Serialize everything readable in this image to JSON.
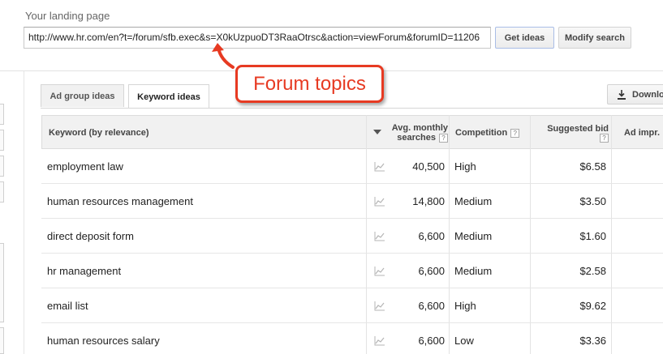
{
  "landing": {
    "label": "Your landing page",
    "url": "http://www.hr.com/en?t=/forum/sfb.exec&s=X0kUzpuoDT3RaaOtrsc&action=viewForum&forumID=11206",
    "get_ideas_label": "Get ideas",
    "modify_search_label": "Modify search"
  },
  "tabs": [
    {
      "label": "Ad group ideas",
      "active": false
    },
    {
      "label": "Keyword ideas",
      "active": true
    }
  ],
  "download_label": "Download",
  "table": {
    "headers": {
      "keyword": "Keyword (by relevance)",
      "avg_line1": "Avg. monthly",
      "avg_line2": "searches",
      "competition": "Competition",
      "bid": "Suggested bid",
      "ad_impr": "Ad impr."
    },
    "help_glyph": "?",
    "rows": [
      {
        "keyword": "employment law",
        "searches": "40,500",
        "competition": "High",
        "bid": "$6.58"
      },
      {
        "keyword": "human resources management",
        "searches": "14,800",
        "competition": "Medium",
        "bid": "$3.50"
      },
      {
        "keyword": "direct deposit form",
        "searches": "6,600",
        "competition": "Medium",
        "bid": "$1.60"
      },
      {
        "keyword": "hr management",
        "searches": "6,600",
        "competition": "Medium",
        "bid": "$2.58"
      },
      {
        "keyword": "email list",
        "searches": "6,600",
        "competition": "High",
        "bid": "$9.62"
      },
      {
        "keyword": "human resources salary",
        "searches": "6,600",
        "competition": "Low",
        "bid": "$3.36"
      }
    ]
  },
  "annotation": {
    "text": "Forum topics",
    "color": "#e73a22"
  },
  "icons": [
    "download-icon",
    "trend-chart-icon",
    "sort-desc-icon",
    "help-icon"
  ]
}
